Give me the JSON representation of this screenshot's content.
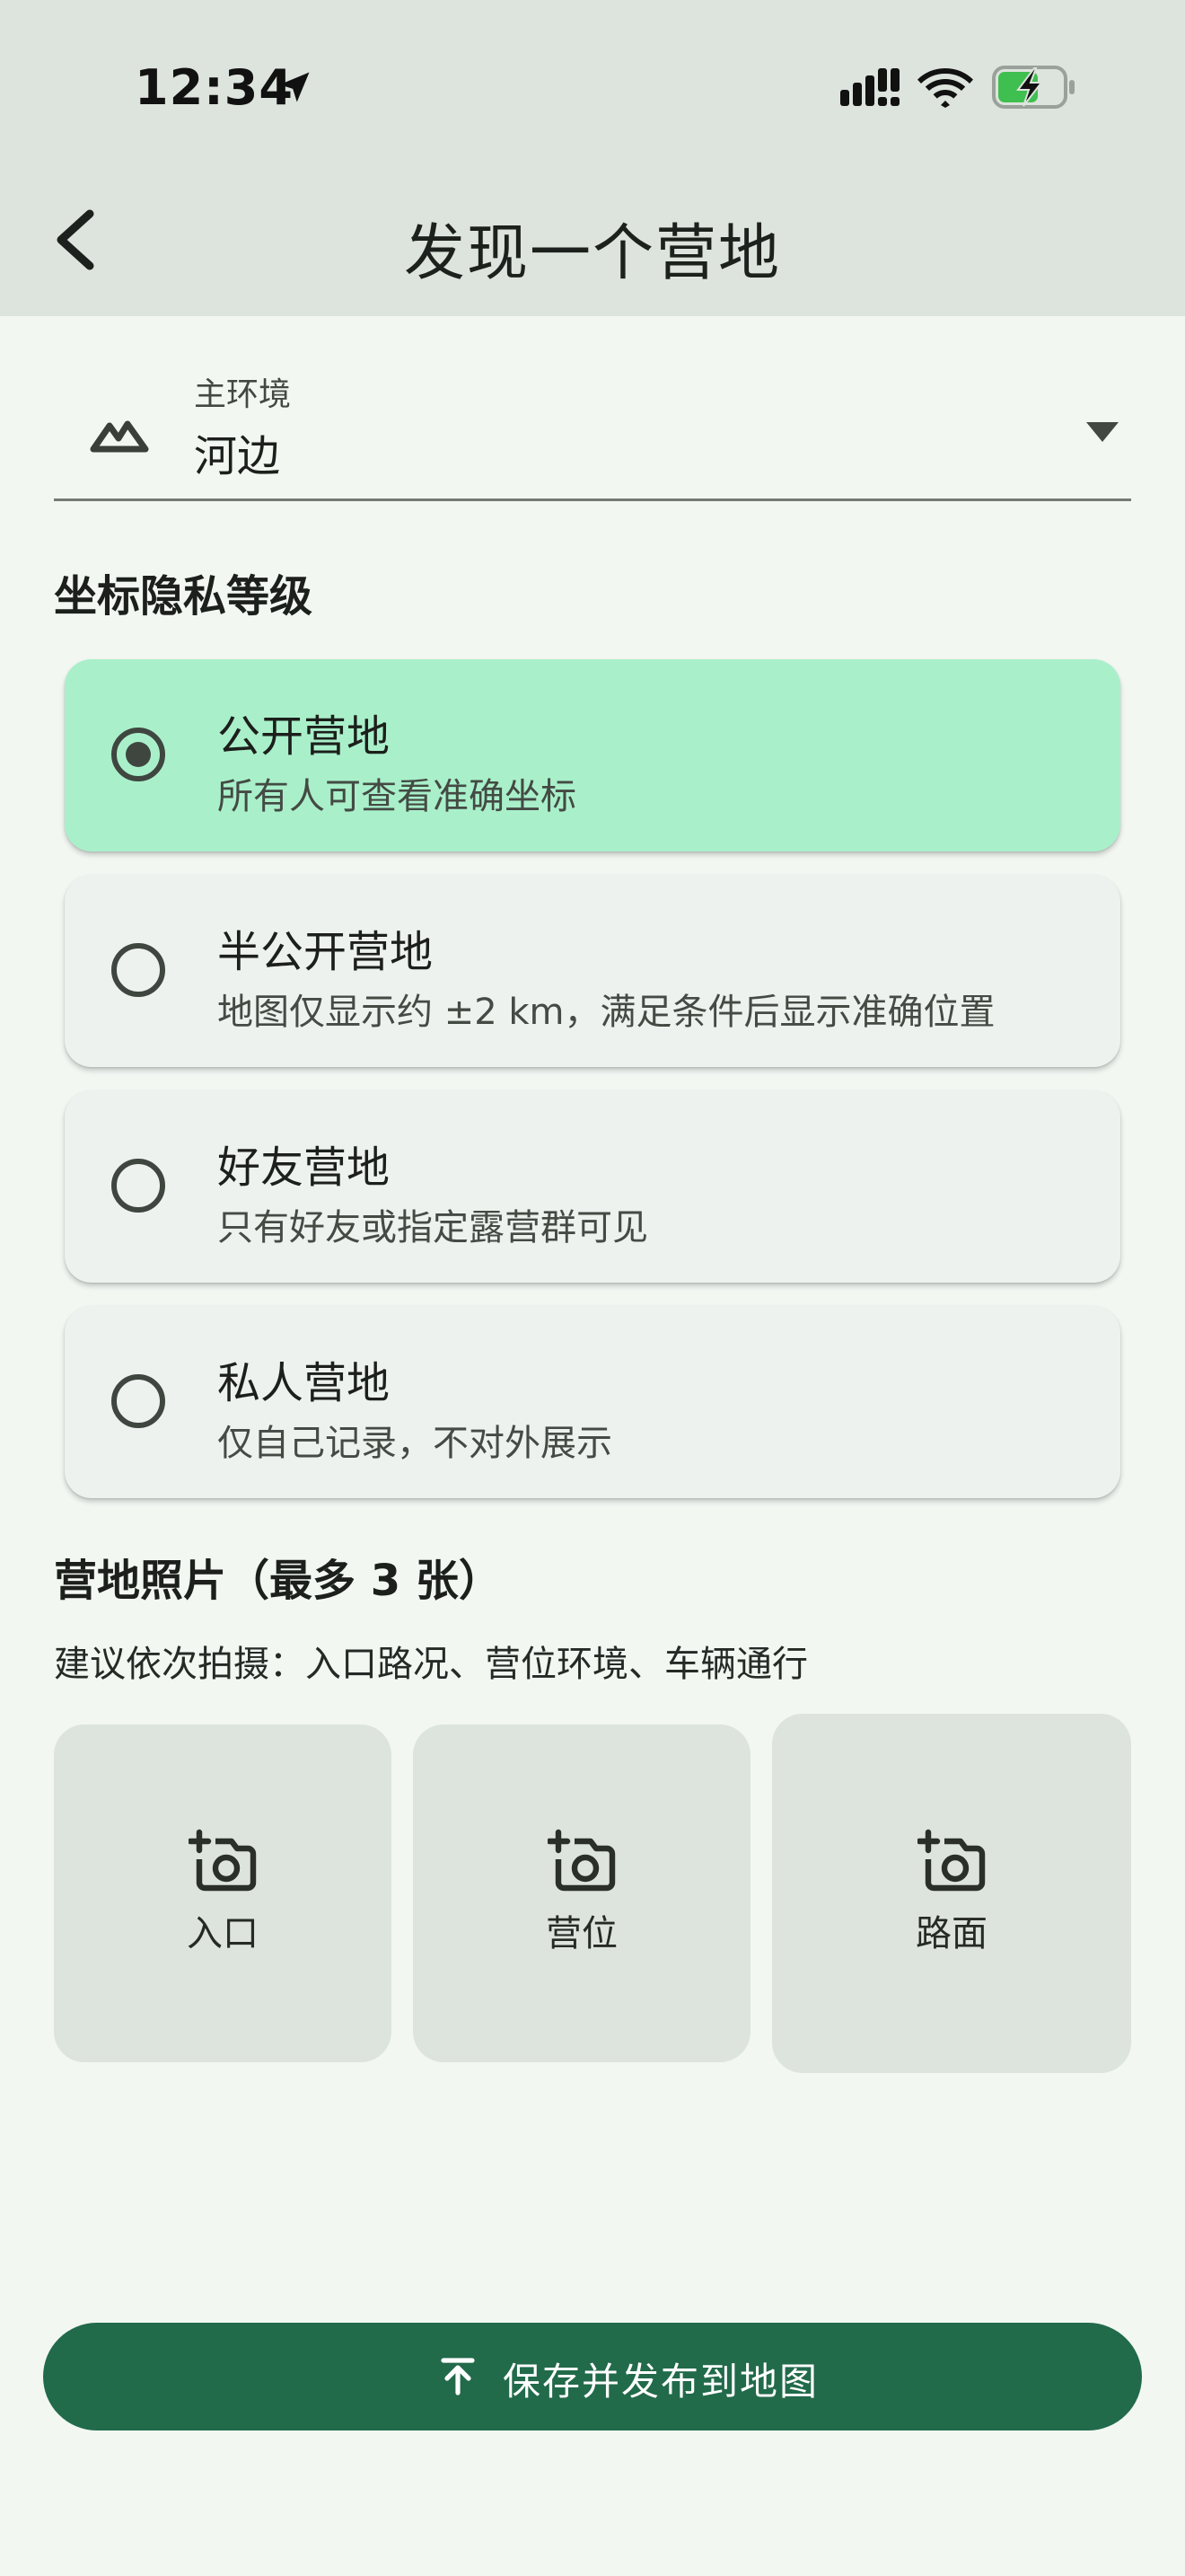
{
  "status_bar": {
    "time": "12:34",
    "icons": [
      "location-arrow-icon",
      "cellular-signal-icon",
      "wifi-icon",
      "battery-charging-icon"
    ]
  },
  "app_bar": {
    "title": "发现一个营地",
    "back_icon": "back-arrow-icon"
  },
  "environment": {
    "label": "主环境",
    "value": "河边",
    "icon": "terrain-icon"
  },
  "privacy": {
    "title": "坐标隐私等级",
    "options": [
      {
        "title": "公开营地",
        "description": "所有人可查看准确坐标",
        "selected": true
      },
      {
        "title": "半公开营地",
        "description": "地图仅显示约 ±2 km，满足条件后显示准确位置",
        "selected": false
      },
      {
        "title": "好友营地",
        "description": "只有好友或指定露营群可见",
        "selected": false
      },
      {
        "title": "私人营地",
        "description": "仅自己记录，不对外展示",
        "selected": false
      }
    ]
  },
  "photos": {
    "title": "营地照片（最多 3 张）",
    "hint": "建议依次拍摄：入口路况、营位环境、车辆通行",
    "tiles": [
      {
        "label": "入口",
        "icon": "add-photo-icon"
      },
      {
        "label": "营位",
        "icon": "add-photo-icon"
      },
      {
        "label": "路面",
        "icon": "add-photo-icon"
      }
    ]
  },
  "save_button": {
    "label": "保存并发布到地图",
    "icon": "publish-icon"
  },
  "colors": {
    "selected_option": "#a9f0ca",
    "primary_button": "#216a4a",
    "top_bar": "#dde3dd",
    "background": "#f2f7f2"
  }
}
